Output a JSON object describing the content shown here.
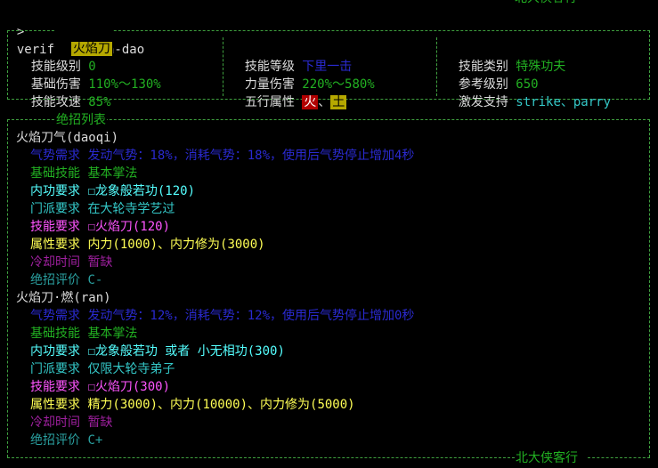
{
  "prompt": {
    "symbol": ">",
    "command": "verify huoyan-dao"
  },
  "header_partial_text": "北大侠客行",
  "info_box": {
    "title": "火焰刀",
    "left": [
      {
        "label": "技能级别",
        "value": "0"
      },
      {
        "label": "基础伤害",
        "value": "110%～130%"
      },
      {
        "label": "技能攻速",
        "value": "85%"
      }
    ],
    "mid": [
      {
        "label": "技能等级",
        "value": "下里一击"
      },
      {
        "label": "力量伤害",
        "value": "220%～580%"
      },
      {
        "label": "五行属性",
        "value_a": "火",
        "sep": "、",
        "value_b": "土"
      }
    ],
    "right": [
      {
        "label": "技能类别",
        "value": "特殊功夫"
      },
      {
        "label": "参考级别",
        "value": "650"
      },
      {
        "label": "激发支持",
        "value": "strike、parry"
      }
    ]
  },
  "moves_box": {
    "title": "绝招列表",
    "footer": "北大侠客行",
    "moves": [
      {
        "name": "火焰刀气(daoqi)",
        "lines": [
          {
            "label": "气势需求",
            "value": "发动气势：18%，消耗气势：18%，使用后气势停止增加4秒"
          },
          {
            "label": "基础技能",
            "value": "基本掌法"
          },
          {
            "label": "内功要求",
            "box": "☐",
            "value": "龙象般若功(120)"
          },
          {
            "label": "门派要求",
            "value": "在大轮寺学艺过"
          },
          {
            "label": "技能要求",
            "box": "☐",
            "value": "火焰刀(120)"
          },
          {
            "label": "属性要求",
            "value": "内力(1000)、内力修为(3000)"
          },
          {
            "label": "冷却时间",
            "value": "暂缺"
          },
          {
            "label": "绝招评价",
            "value": "C-"
          }
        ]
      },
      {
        "name": "火焰刀·燃(ran)",
        "lines": [
          {
            "label": "气势需求",
            "value": "发动气势：12%，消耗气势：12%，使用后气势停止增加0秒"
          },
          {
            "label": "基础技能",
            "value": "基本掌法"
          },
          {
            "label": "内功要求",
            "box": "☐",
            "value": "龙象般若功 或者 小无相功(300)"
          },
          {
            "label": "门派要求",
            "value": "仅限大轮寺弟子"
          },
          {
            "label": "技能要求",
            "box": "☐",
            "value": "火焰刀(300)"
          },
          {
            "label": "属性要求",
            "value": "精力(3000)、内力(10000)、内力修为(5000)"
          },
          {
            "label": "冷却时间",
            "value": "暂缺"
          },
          {
            "label": "绝招评价",
            "value": "C+"
          }
        ]
      }
    ]
  }
}
